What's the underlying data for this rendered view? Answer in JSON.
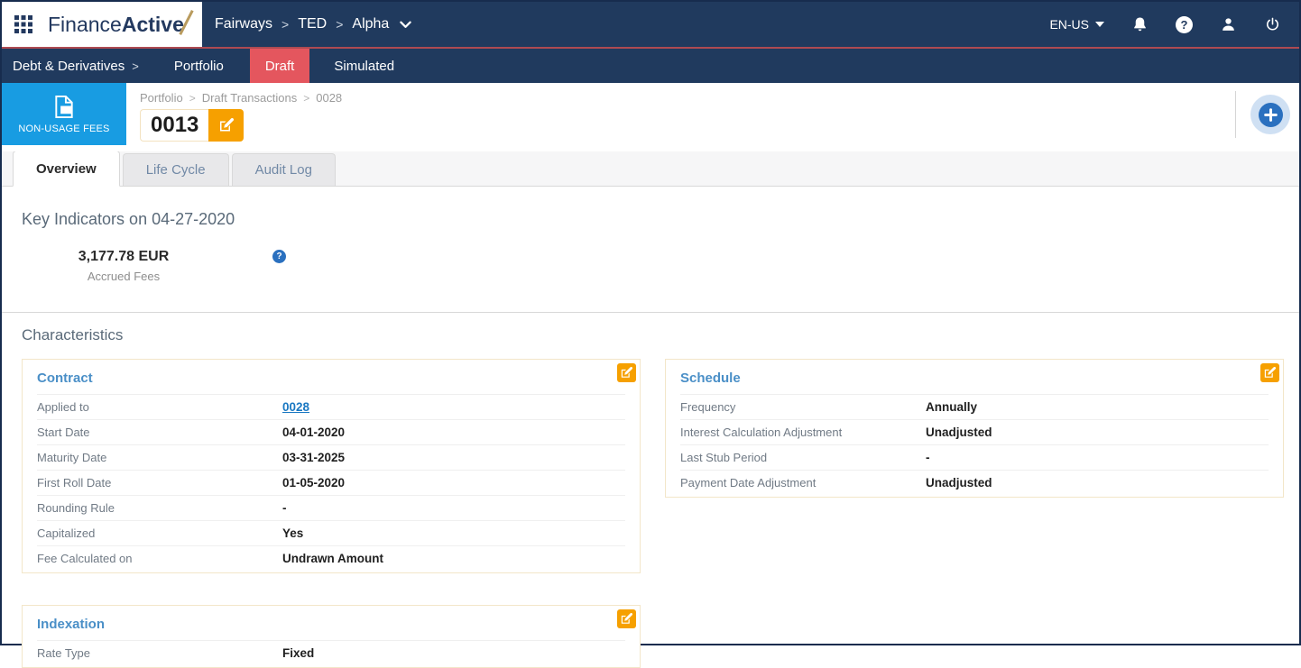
{
  "misc": {
    "breadcrumb_separator": ">",
    "question_glyph": "?"
  },
  "colors": {
    "navy": "#203a5e",
    "accent_red_line": "#ae4a52",
    "draft_active_red": "#e4565e",
    "module_blue": "#189ce2",
    "edit_orange": "#f6a000",
    "link_blue": "#1a78c2",
    "panel_title_blue": "#4a8fc7"
  },
  "top_bar": {
    "logo_finance": "Finance",
    "logo_active": "Active",
    "breadcrumb": [
      "Fairways",
      "TED",
      "Alpha"
    ],
    "language": "EN-US"
  },
  "nav_bar": {
    "section_label": "Debt & Derivatives",
    "items": [
      {
        "label": "Portfolio",
        "active": false
      },
      {
        "label": "Draft",
        "active": true
      },
      {
        "label": "Simulated",
        "active": false
      }
    ]
  },
  "page_header": {
    "module_label": "NON-USAGE FEES",
    "breadcrumb": [
      "Portfolio",
      "Draft Transactions",
      "0028"
    ],
    "title": "0013"
  },
  "tabs": [
    {
      "label": "Overview",
      "active": true
    },
    {
      "label": "Life Cycle",
      "active": false
    },
    {
      "label": "Audit Log",
      "active": false
    }
  ],
  "key_indicators": {
    "heading": "Key Indicators on 04-27-2020",
    "metric_value": "3,177.78 EUR",
    "metric_label": "Accrued Fees"
  },
  "characteristics": {
    "heading": "Characteristics",
    "contract": {
      "title": "Contract",
      "rows": [
        {
          "label": "Applied to",
          "value": "0028"
        },
        {
          "label": "Start Date",
          "value": "04-01-2020"
        },
        {
          "label": "Maturity Date",
          "value": "03-31-2025"
        },
        {
          "label": "First Roll Date",
          "value": "01-05-2020"
        },
        {
          "label": "Rounding Rule",
          "value": "-"
        },
        {
          "label": "Capitalized",
          "value": "Yes"
        },
        {
          "label": "Fee Calculated on",
          "value": "Undrawn Amount"
        }
      ]
    },
    "schedule": {
      "title": "Schedule",
      "rows": [
        {
          "label": "Frequency",
          "value": "Annually"
        },
        {
          "label": "Interest Calculation Adjustment",
          "value": "Unadjusted"
        },
        {
          "label": "Last Stub Period",
          "value": "-"
        },
        {
          "label": "Payment Date Adjustment",
          "value": "Unadjusted"
        }
      ]
    },
    "indexation": {
      "title": "Indexation",
      "rows": [
        {
          "label": "Rate Type",
          "value": "Fixed"
        }
      ]
    }
  }
}
